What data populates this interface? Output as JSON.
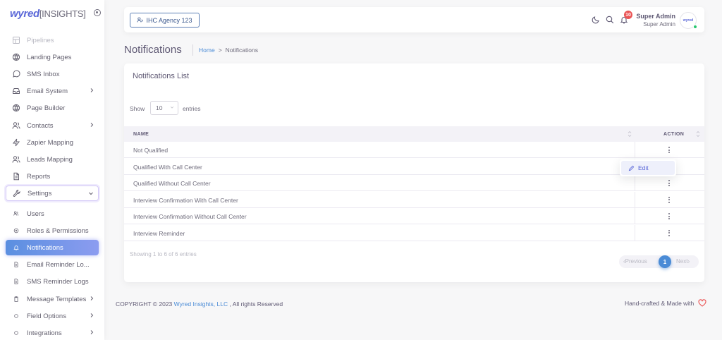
{
  "brand": {
    "part1": "wyred",
    "part2": "[INSIGHTS]"
  },
  "sidebar": {
    "items": [
      {
        "label": "Pipelines",
        "icon": "pipeline-icon",
        "faded": true
      },
      {
        "label": "Landing Pages",
        "icon": "globe-icon"
      },
      {
        "label": "SMS Inbox",
        "icon": "message-circle-icon"
      },
      {
        "label": "Email System",
        "icon": "inbox-icon",
        "has_children": true
      },
      {
        "label": "Page Builder",
        "icon": "globe-icon"
      },
      {
        "label": "Contacts",
        "icon": "users-icon",
        "has_children": true
      },
      {
        "label": "Zapier Mapping",
        "icon": "zap-icon"
      },
      {
        "label": "Leads Mapping",
        "icon": "users-icon"
      },
      {
        "label": "Reports",
        "icon": "file-text-icon"
      },
      {
        "label": "Settings",
        "icon": "tool-icon",
        "expanded": true
      },
      {
        "label": "Users",
        "icon": "users-small-icon",
        "sub": true
      },
      {
        "label": "Roles & Permissions",
        "icon": "disc-icon",
        "sub": true
      },
      {
        "label": "Notifications",
        "icon": "bell-small-icon",
        "sub": true,
        "active": true
      },
      {
        "label": "Email Reminder Lo...",
        "icon": "file-small-icon",
        "sub": true
      },
      {
        "label": "SMS Reminder Logs",
        "icon": "file-small-icon",
        "sub": true
      },
      {
        "label": "Message Templates",
        "icon": "clipboard-icon",
        "sub": true,
        "has_children": true
      },
      {
        "label": "Field Options",
        "icon": "circle-icon",
        "sub": true,
        "has_children": true
      },
      {
        "label": "Integrations",
        "icon": "circle-icon",
        "sub": true,
        "has_children": true
      }
    ]
  },
  "header": {
    "agency_label": "IHC Agency 123",
    "notification_count": "10",
    "user_name": "Super Admin",
    "user_role": "Super Admin",
    "avatar_text": "wyred"
  },
  "page": {
    "title": "Notifications",
    "breadcrumb_home": "Home",
    "breadcrumb_sep": ">",
    "breadcrumb_current": "Notifications"
  },
  "card": {
    "title": "Notifications List",
    "show_label": "Show",
    "entries_value": "10",
    "entries_label": "entries",
    "columns": {
      "name": "NAME",
      "action": "ACTION"
    },
    "rows": [
      "Not Qualified",
      "Qualified With Call Center",
      "Qualified Without Call Center",
      "Interview Confirmation With Call Center",
      "Interview Confirmation Without Call Center",
      "Interview Reminder"
    ],
    "dropdown_edit": "Edit",
    "showing": "Showing 1 to 6 of 6 entries",
    "pager": {
      "prev": "Previous",
      "current": "1",
      "next": "Next"
    }
  },
  "footer": {
    "copyright_prefix": "COPYRIGHT © 2023",
    "company": "Wyred Insights, LLC",
    "copyright_suffix": ", All rights Reserved",
    "crafted": "Hand-crafted & Made with"
  },
  "colors": {
    "accent": "#4a8bd6",
    "active_gradient_start": "#5a8fe0",
    "badge": "#ea5455"
  }
}
